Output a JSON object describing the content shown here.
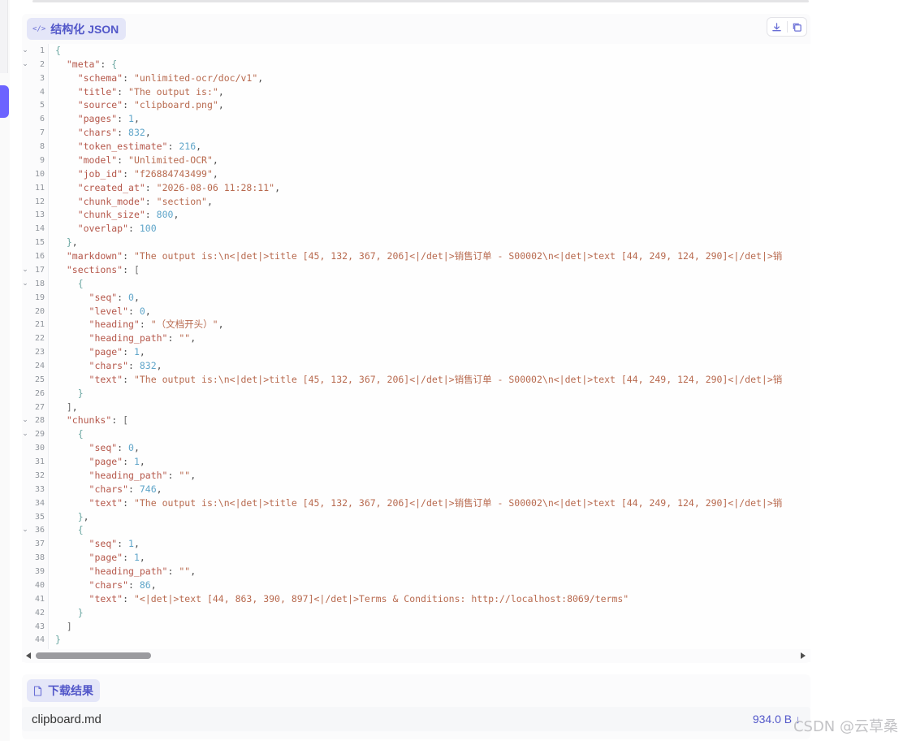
{
  "json_panel": {
    "title": "结构化 JSON",
    "badge_icon": "</>",
    "download_icon": "download-icon",
    "copy_icon": "copy-icon"
  },
  "code_lines": [
    {
      "n": "1",
      "fold": "⌄",
      "t": [
        [
          "{",
          "br2"
        ]
      ]
    },
    {
      "n": "2",
      "fold": "⌄",
      "t": [
        [
          "  "
        ],
        [
          "\"meta\"",
          "key"
        ],
        [
          ": "
        ],
        [
          "{",
          "br2"
        ]
      ]
    },
    {
      "n": "3",
      "fold": "",
      "t": [
        [
          "    "
        ],
        [
          "\"schema\"",
          "key"
        ],
        [
          ": "
        ],
        [
          "\"unlimited-ocr/doc/v1\"",
          "str"
        ],
        [
          ","
        ]
      ]
    },
    {
      "n": "4",
      "fold": "",
      "t": [
        [
          "    "
        ],
        [
          "\"title\"",
          "key"
        ],
        [
          ": "
        ],
        [
          "\"The output is:\"",
          "str"
        ],
        [
          ","
        ]
      ]
    },
    {
      "n": "5",
      "fold": "",
      "t": [
        [
          "    "
        ],
        [
          "\"source\"",
          "key"
        ],
        [
          ": "
        ],
        [
          "\"clipboard.png\"",
          "str"
        ],
        [
          ","
        ]
      ]
    },
    {
      "n": "6",
      "fold": "",
      "t": [
        [
          "    "
        ],
        [
          "\"pages\"",
          "key"
        ],
        [
          ": "
        ],
        [
          "1",
          "num"
        ],
        [
          ","
        ]
      ]
    },
    {
      "n": "7",
      "fold": "",
      "t": [
        [
          "    "
        ],
        [
          "\"chars\"",
          "key"
        ],
        [
          ": "
        ],
        [
          "832",
          "num"
        ],
        [
          ","
        ]
      ]
    },
    {
      "n": "8",
      "fold": "",
      "t": [
        [
          "    "
        ],
        [
          "\"token_estimate\"",
          "key"
        ],
        [
          ": "
        ],
        [
          "216",
          "num"
        ],
        [
          ","
        ]
      ]
    },
    {
      "n": "9",
      "fold": "",
      "t": [
        [
          "    "
        ],
        [
          "\"model\"",
          "key"
        ],
        [
          ": "
        ],
        [
          "\"Unlimited-OCR\"",
          "str"
        ],
        [
          ","
        ]
      ]
    },
    {
      "n": "10",
      "fold": "",
      "t": [
        [
          "    "
        ],
        [
          "\"job_id\"",
          "key"
        ],
        [
          ": "
        ],
        [
          "\"f26884743499\"",
          "str"
        ],
        [
          ","
        ]
      ]
    },
    {
      "n": "11",
      "fold": "",
      "t": [
        [
          "    "
        ],
        [
          "\"created_at\"",
          "key"
        ],
        [
          ": "
        ],
        [
          "\"2026-08-06 11:28:11\"",
          "str"
        ],
        [
          ","
        ]
      ]
    },
    {
      "n": "12",
      "fold": "",
      "t": [
        [
          "    "
        ],
        [
          "\"chunk_mode\"",
          "key"
        ],
        [
          ": "
        ],
        [
          "\"section\"",
          "str"
        ],
        [
          ","
        ]
      ]
    },
    {
      "n": "13",
      "fold": "",
      "t": [
        [
          "    "
        ],
        [
          "\"chunk_size\"",
          "key"
        ],
        [
          ": "
        ],
        [
          "800",
          "num"
        ],
        [
          ","
        ]
      ]
    },
    {
      "n": "14",
      "fold": "",
      "t": [
        [
          "    "
        ],
        [
          "\"overlap\"",
          "key"
        ],
        [
          ": "
        ],
        [
          "100",
          "num"
        ]
      ]
    },
    {
      "n": "15",
      "fold": "",
      "t": [
        [
          "  "
        ],
        [
          "}",
          "br2"
        ],
        [
          ","
        ]
      ]
    },
    {
      "n": "16",
      "fold": "",
      "t": [
        [
          "  "
        ],
        [
          "\"markdown\"",
          "key"
        ],
        [
          ": "
        ],
        [
          "\"The output is:\\n<|det|>title [45, 132, 367, 206]<|/det|>销售订单 - S00002\\n<|det|>text [44, 249, 124, 290]<|/det|>销",
          "str"
        ]
      ]
    },
    {
      "n": "17",
      "fold": "⌄",
      "t": [
        [
          "  "
        ],
        [
          "\"sections\"",
          "key"
        ],
        [
          ": "
        ],
        [
          "[",
          "br"
        ]
      ]
    },
    {
      "n": "18",
      "fold": "⌄",
      "t": [
        [
          "    "
        ],
        [
          "{",
          "br2"
        ]
      ]
    },
    {
      "n": "19",
      "fold": "",
      "t": [
        [
          "      "
        ],
        [
          "\"seq\"",
          "key"
        ],
        [
          ": "
        ],
        [
          "0",
          "num"
        ],
        [
          ","
        ]
      ]
    },
    {
      "n": "20",
      "fold": "",
      "t": [
        [
          "      "
        ],
        [
          "\"level\"",
          "key"
        ],
        [
          ": "
        ],
        [
          "0",
          "num"
        ],
        [
          ","
        ]
      ]
    },
    {
      "n": "21",
      "fold": "",
      "t": [
        [
          "      "
        ],
        [
          "\"heading\"",
          "key"
        ],
        [
          ": "
        ],
        [
          "\"（文档开头）\"",
          "str"
        ],
        [
          ","
        ]
      ]
    },
    {
      "n": "22",
      "fold": "",
      "t": [
        [
          "      "
        ],
        [
          "\"heading_path\"",
          "key"
        ],
        [
          ": "
        ],
        [
          "\"\"",
          "str"
        ],
        [
          ","
        ]
      ]
    },
    {
      "n": "23",
      "fold": "",
      "t": [
        [
          "      "
        ],
        [
          "\"page\"",
          "key"
        ],
        [
          ": "
        ],
        [
          "1",
          "num"
        ],
        [
          ","
        ]
      ]
    },
    {
      "n": "24",
      "fold": "",
      "t": [
        [
          "      "
        ],
        [
          "\"chars\"",
          "key"
        ],
        [
          ": "
        ],
        [
          "832",
          "num"
        ],
        [
          ","
        ]
      ]
    },
    {
      "n": "25",
      "fold": "",
      "t": [
        [
          "      "
        ],
        [
          "\"text\"",
          "key"
        ],
        [
          ": "
        ],
        [
          "\"The output is:\\n<|det|>title [45, 132, 367, 206]<|/det|>销售订单 - S00002\\n<|det|>text [44, 249, 124, 290]<|/det|>销",
          "str"
        ]
      ]
    },
    {
      "n": "26",
      "fold": "",
      "t": [
        [
          "    "
        ],
        [
          "}",
          "br2"
        ]
      ]
    },
    {
      "n": "27",
      "fold": "",
      "t": [
        [
          "  "
        ],
        [
          "]",
          "br"
        ],
        [
          ","
        ]
      ]
    },
    {
      "n": "28",
      "fold": "⌄",
      "t": [
        [
          "  "
        ],
        [
          "\"chunks\"",
          "key"
        ],
        [
          ": "
        ],
        [
          "[",
          "br"
        ]
      ]
    },
    {
      "n": "29",
      "fold": "⌄",
      "t": [
        [
          "    "
        ],
        [
          "{",
          "br2"
        ]
      ]
    },
    {
      "n": "30",
      "fold": "",
      "t": [
        [
          "      "
        ],
        [
          "\"seq\"",
          "key"
        ],
        [
          ": "
        ],
        [
          "0",
          "num"
        ],
        [
          ","
        ]
      ]
    },
    {
      "n": "31",
      "fold": "",
      "t": [
        [
          "      "
        ],
        [
          "\"page\"",
          "key"
        ],
        [
          ": "
        ],
        [
          "1",
          "num"
        ],
        [
          ","
        ]
      ]
    },
    {
      "n": "32",
      "fold": "",
      "t": [
        [
          "      "
        ],
        [
          "\"heading_path\"",
          "key"
        ],
        [
          ": "
        ],
        [
          "\"\"",
          "str"
        ],
        [
          ","
        ]
      ]
    },
    {
      "n": "33",
      "fold": "",
      "t": [
        [
          "      "
        ],
        [
          "\"chars\"",
          "key"
        ],
        [
          ": "
        ],
        [
          "746",
          "num"
        ],
        [
          ","
        ]
      ]
    },
    {
      "n": "34",
      "fold": "",
      "t": [
        [
          "      "
        ],
        [
          "\"text\"",
          "key"
        ],
        [
          ": "
        ],
        [
          "\"The output is:\\n<|det|>title [45, 132, 367, 206]<|/det|>销售订单 - S00002\\n<|det|>text [44, 249, 124, 290]<|/det|>销",
          "str"
        ]
      ]
    },
    {
      "n": "35",
      "fold": "",
      "t": [
        [
          "    "
        ],
        [
          "}",
          "br2"
        ],
        [
          ","
        ]
      ]
    },
    {
      "n": "36",
      "fold": "⌄",
      "t": [
        [
          "    "
        ],
        [
          "{",
          "br2"
        ]
      ]
    },
    {
      "n": "37",
      "fold": "",
      "t": [
        [
          "      "
        ],
        [
          "\"seq\"",
          "key"
        ],
        [
          ": "
        ],
        [
          "1",
          "num"
        ],
        [
          ","
        ]
      ]
    },
    {
      "n": "38",
      "fold": "",
      "t": [
        [
          "      "
        ],
        [
          "\"page\"",
          "key"
        ],
        [
          ": "
        ],
        [
          "1",
          "num"
        ],
        [
          ","
        ]
      ]
    },
    {
      "n": "39",
      "fold": "",
      "t": [
        [
          "      "
        ],
        [
          "\"heading_path\"",
          "key"
        ],
        [
          ": "
        ],
        [
          "\"\"",
          "str"
        ],
        [
          ","
        ]
      ]
    },
    {
      "n": "40",
      "fold": "",
      "t": [
        [
          "      "
        ],
        [
          "\"chars\"",
          "key"
        ],
        [
          ": "
        ],
        [
          "86",
          "num"
        ],
        [
          ","
        ]
      ]
    },
    {
      "n": "41",
      "fold": "",
      "t": [
        [
          "      "
        ],
        [
          "\"text\"",
          "key"
        ],
        [
          ": "
        ],
        [
          "\"<|det|>text [44, 863, 390, 897]<|/det|>Terms & Conditions: http://localhost:8069/terms\"",
          "str"
        ]
      ]
    },
    {
      "n": "42",
      "fold": "",
      "t": [
        [
          "    "
        ],
        [
          "}",
          "br2"
        ]
      ]
    },
    {
      "n": "43",
      "fold": "",
      "t": [
        [
          "  "
        ],
        [
          "]",
          "br"
        ]
      ]
    },
    {
      "n": "44",
      "fold": "",
      "t": [
        [
          "}",
          "br2"
        ]
      ]
    }
  ],
  "download_panel": {
    "title": "下载结果",
    "file_icon": "file-icon",
    "file_name": "clipboard.md",
    "file_size": "934.0 B ↓"
  },
  "watermark": "CSDN @云草桑",
  "colors": {
    "accent": "#5257c9",
    "badge_bg": "#e4e6f8",
    "key": "#b5574a",
    "string": "#b86a4f",
    "number": "#5fa5c9"
  }
}
